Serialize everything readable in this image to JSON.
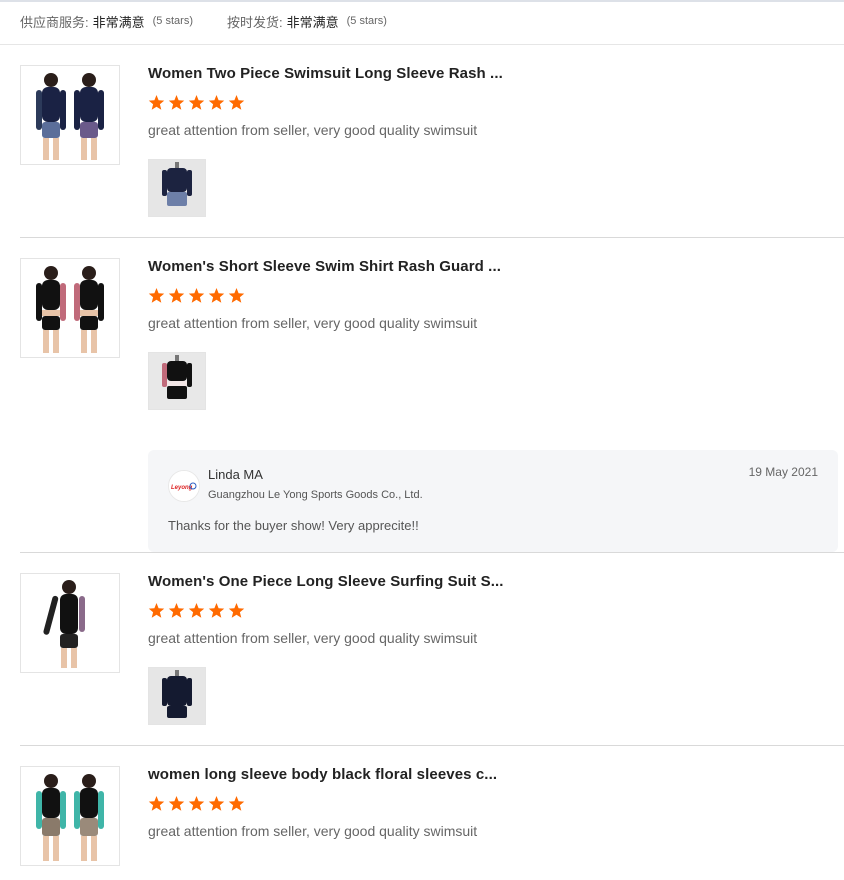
{
  "summary": {
    "supplier_service_label": "供应商服务:",
    "supplier_service_value": "非常满意",
    "supplier_service_stars": "(5 stars)",
    "ontime_label": "按时发货:",
    "ontime_value": "非常满意",
    "ontime_stars": "(5 stars)"
  },
  "reviews": [
    {
      "title": "Women Two Piece Swimsuit Long Sleeve Rash ...",
      "rating": 5,
      "comment": "great attention from seller, very good quality swimsuit"
    },
    {
      "title": "Women's Short Sleeve Swim Shirt Rash Guard ...",
      "rating": 5,
      "comment": "great attention from seller, very good quality swimsuit",
      "reply": {
        "name": "Linda MA",
        "company": "Guangzhou Le Yong Sports Goods Co., Ltd.",
        "date": "19 May 2021",
        "text": "Thanks for the buyer show! Very apprecite!!"
      }
    },
    {
      "title": "Women's One Piece Long Sleeve Surfing Suit S...",
      "rating": 5,
      "comment": "great attention from seller, very good quality swimsuit"
    },
    {
      "title": "women long sleeve body black floral sleeves c...",
      "rating": 5,
      "comment": "great attention from seller, very good quality swimsuit"
    }
  ],
  "colors": {
    "star": "#ff6a00",
    "reply_bg": "#f5f6f8",
    "divider": "#d9d9d9"
  },
  "icons": [
    "star-icon",
    "product-thumbnail",
    "review-photo",
    "seller-logo"
  ]
}
